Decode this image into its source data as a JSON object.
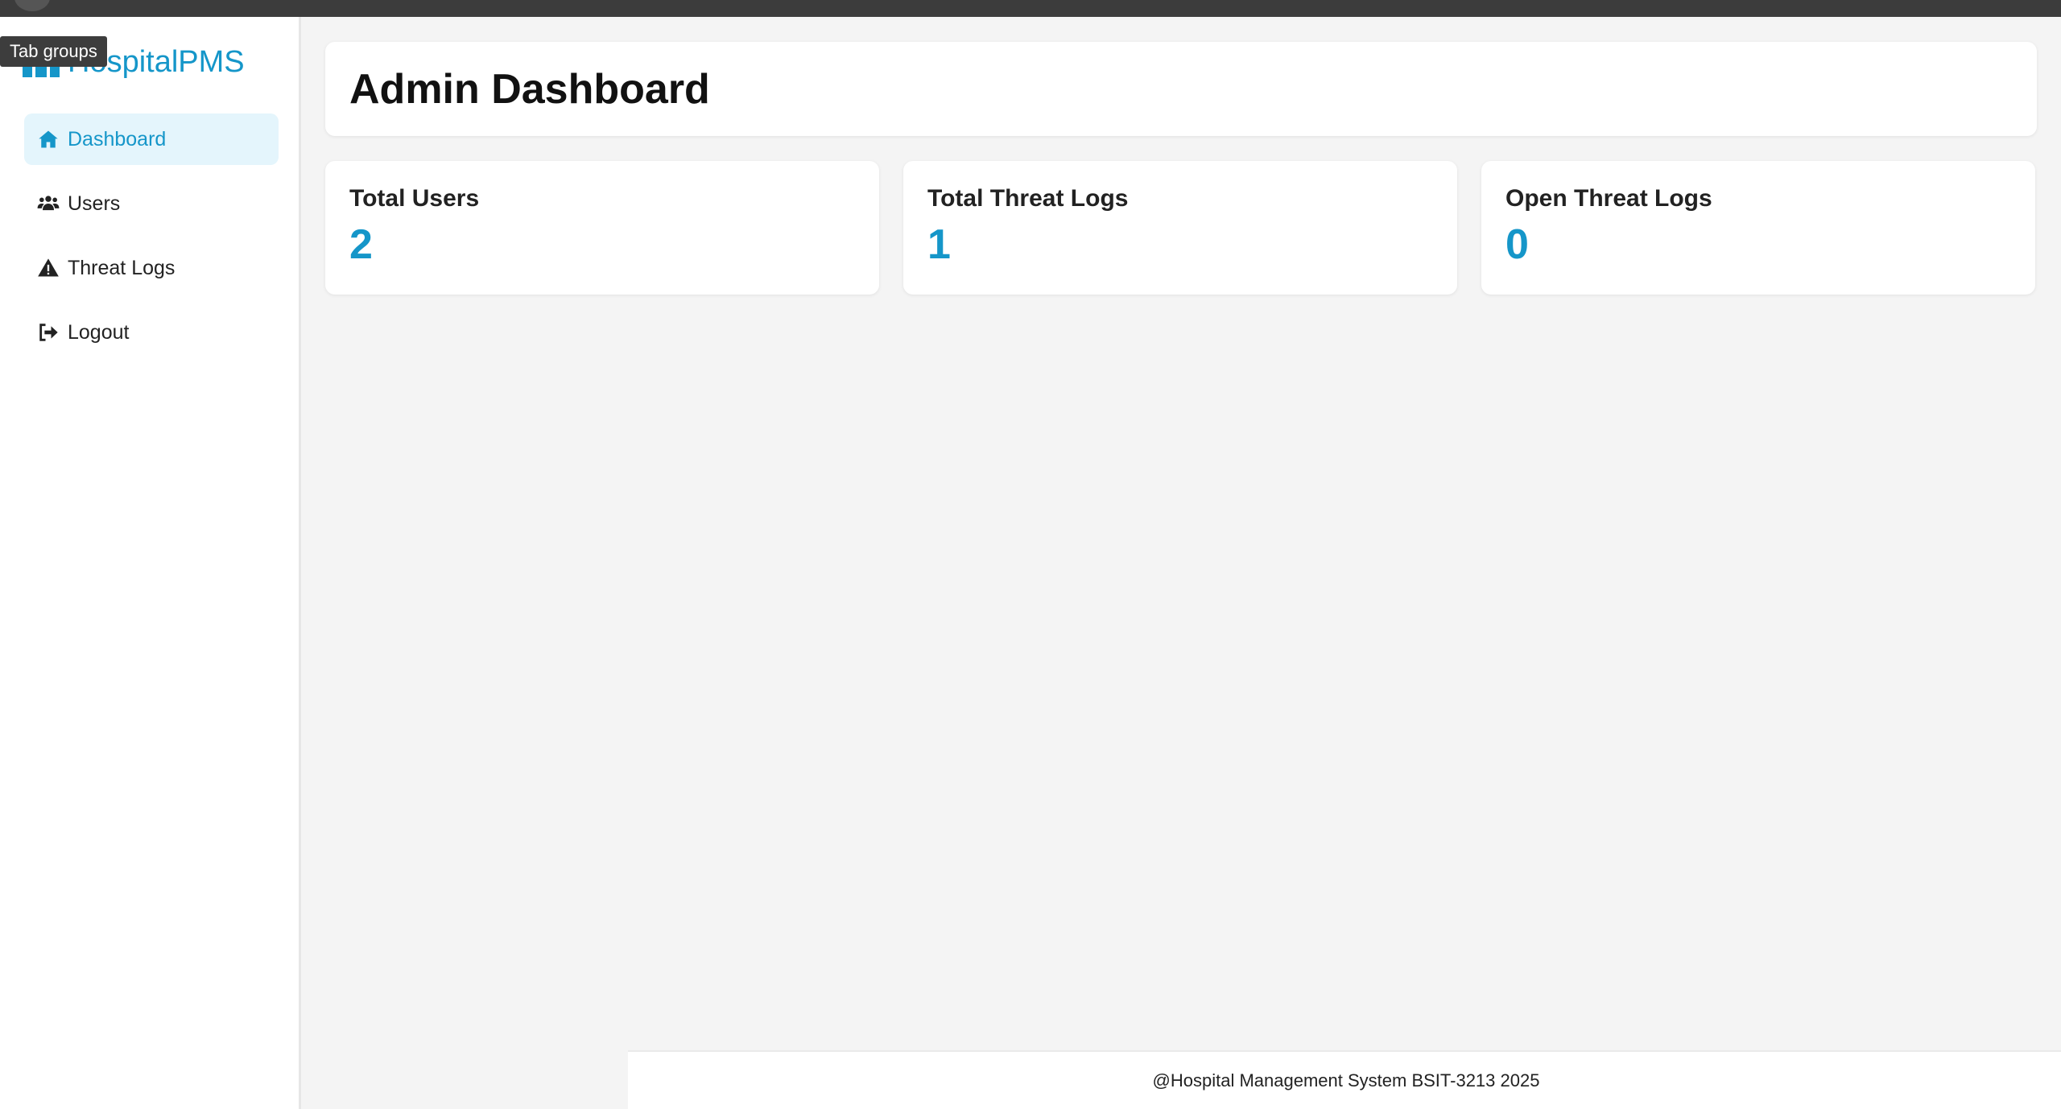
{
  "tooltip": "Tab groups",
  "brand": {
    "name": "HospitalPMS"
  },
  "sidebar": {
    "items": [
      {
        "label": "Dashboard",
        "icon": "home-icon",
        "active": true
      },
      {
        "label": "Users",
        "icon": "users-icon",
        "active": false
      },
      {
        "label": "Threat Logs",
        "icon": "warning-icon",
        "active": false
      },
      {
        "label": "Logout",
        "icon": "logout-icon",
        "active": false
      }
    ]
  },
  "header": {
    "title": "Admin Dashboard"
  },
  "stats": [
    {
      "label": "Total Users",
      "value": "2"
    },
    {
      "label": "Total Threat Logs",
      "value": "1"
    },
    {
      "label": "Open Threat Logs",
      "value": "0"
    }
  ],
  "footer": {
    "text": "@Hospital Management System BSIT-3213 2025"
  },
  "colors": {
    "accent": "#1596c9",
    "active_bg": "#e4f5fc",
    "page_bg": "#f4f4f4",
    "topbar": "#3c3c3c"
  }
}
